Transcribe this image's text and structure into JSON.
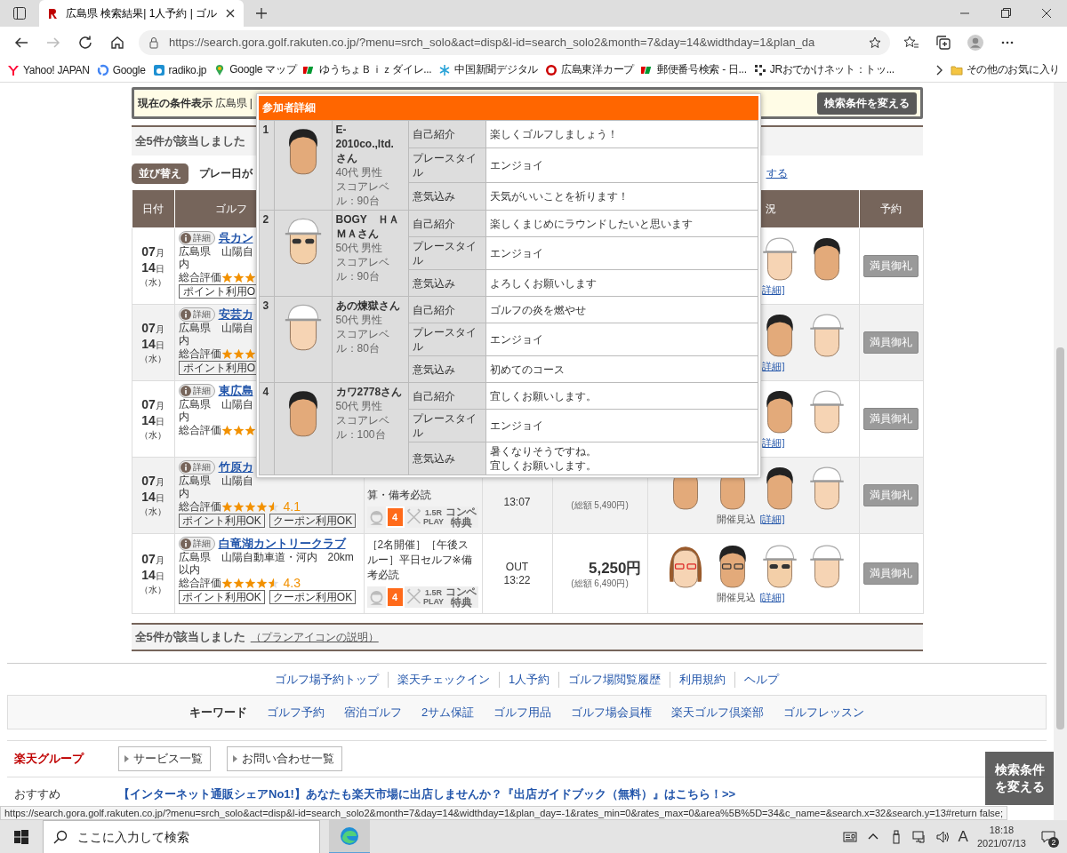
{
  "browser": {
    "tab_title": "広島県 検索結果| 1人予約 | ゴル",
    "address": "https://search.gora.golf.rakuten.co.jp/?menu=srch_solo&act=disp&l-id=search_solo2&month=7&day=14&widthday=1&plan_da",
    "bookmarks": [
      {
        "kind": "yahoo",
        "label": "Yahoo! JAPAN"
      },
      {
        "kind": "google",
        "label": "Google"
      },
      {
        "kind": "radio",
        "label": "radiko.jp"
      },
      {
        "kind": "pin",
        "label": "Google マップ"
      },
      {
        "kind": "post",
        "label": "ゆうちょＢｉｚダイレ..."
      },
      {
        "kind": "snow",
        "label": "中国新聞デジタル"
      },
      {
        "kind": "ball",
        "label": "広島東洋カープ"
      },
      {
        "kind": "post",
        "label": "郵便番号検索 - 日..."
      },
      {
        "kind": "grid",
        "label": "JRおでかけネット：トッ..."
      }
    ],
    "other_favorites": "その他のお気に入り"
  },
  "condition_bar": {
    "label": "現在の条件表示",
    "value": "広島県 |",
    "button": "検索条件を変える"
  },
  "result_count_top": "全5件が該当しました",
  "sort": {
    "button": "並び替え",
    "current": "プレー日が",
    "link": "する"
  },
  "table": {
    "header": {
      "date": "日付",
      "course": "ゴルフ",
      "status": "況",
      "reserve": "予約"
    },
    "rows": [
      {
        "month": "07",
        "month_unit": "月",
        "day": "14",
        "day_unit": "日",
        "weekday": "（水）",
        "badge": "詳細",
        "course": "呉カン",
        "address": "広島県　山陽自",
        "address_tail": "内",
        "rating_label": "総合評価",
        "stars": 3,
        "coupons": [
          "ポイント利用O"
        ],
        "avatars": [
          {
            "kind": "cap"
          },
          {
            "kind": "hair"
          }
        ],
        "status_link": "詳細]",
        "reserve": "満員御礼"
      },
      {
        "month": "07",
        "month_unit": "月",
        "day": "14",
        "day_unit": "日",
        "weekday": "（水）",
        "badge": "詳細",
        "course": "安芸カ",
        "address": "広島県　山陽自",
        "address_tail": "内",
        "rating_label": "総合評価",
        "stars": 3,
        "coupons": [
          "ポイント利用O"
        ],
        "avatars": [
          {
            "kind": "hair"
          },
          {
            "kind": "cap"
          }
        ],
        "status_link": "詳細]",
        "reserve": "満員御礼"
      },
      {
        "month": "07",
        "month_unit": "月",
        "day": "14",
        "day_unit": "日",
        "weekday": "（水）",
        "badge": "詳細",
        "course": "東広島",
        "address": "広島県　山陽自",
        "address_tail": "内",
        "rating_label": "総合評価",
        "stars": 3,
        "avatars": [
          {
            "kind": "hair"
          },
          {
            "kind": "cap"
          }
        ],
        "status_link": "詳細]",
        "reserve": "満員御礼"
      },
      {
        "month": "07",
        "month_unit": "月",
        "day": "14",
        "day_unit": "日",
        "weekday": "（水）",
        "badge": "詳細",
        "course": "竹原カ",
        "address": "広島県　山陽自",
        "address_tail": "内",
        "rating_label": "総合評価",
        "stars": 4.5,
        "rating": "4.1",
        "coupons": [
          "ポイント利用OK",
          "クーポン利用OK"
        ],
        "plan": "算・備考必読",
        "plan_icons": [
          {
            "kind": "caddie",
            "active": false
          },
          {
            "kind": "cart",
            "label": "4",
            "active": true
          },
          {
            "kind": "meal",
            "active": false
          },
          {
            "kind": "play",
            "label": "1.5R PLAY",
            "active": false
          },
          {
            "kind": "compe",
            "label": "コンペ特典",
            "active": false
          }
        ],
        "time": "13:07",
        "total": "(総額 5,490円)",
        "avatars": [
          {
            "kind": "plain"
          },
          {
            "kind": "plain"
          },
          {
            "kind": "hair"
          },
          {
            "kind": "cap"
          }
        ],
        "status_note": "開催見込",
        "status_link": "[詳細]",
        "reserve": "満員御礼"
      },
      {
        "month": "07",
        "month_unit": "月",
        "day": "14",
        "day_unit": "日",
        "weekday": "（水）",
        "badge": "詳細",
        "course": "白竜湖カントリークラブ",
        "address": "広島県　山陽自動車道・河内　20km以内",
        "rating_label": "総合評価",
        "stars": 4.5,
        "rating": "4.3",
        "coupons": [
          "ポイント利用OK",
          "クーポン利用OK"
        ],
        "plan": "［2名開催］［午後スルー］平日セルフ※備考必読",
        "plan_icons": [
          {
            "kind": "caddie",
            "active": false
          },
          {
            "kind": "cart",
            "label": "4",
            "active": true
          },
          {
            "kind": "meal",
            "active": false
          },
          {
            "kind": "play",
            "label": "1.5R PLAY",
            "active": false
          },
          {
            "kind": "compe",
            "label": "コンペ特典",
            "active": false
          }
        ],
        "course_side": "OUT",
        "time": "13:22",
        "price": "5,250円",
        "total": "(総額 6,490円)",
        "avatars": [
          {
            "kind": "woman"
          },
          {
            "kind": "glasses"
          },
          {
            "kind": "sunglasses"
          },
          {
            "kind": "cap"
          }
        ],
        "status_note": "開催見込",
        "status_link": "[詳細]",
        "reserve": "満員御礼"
      }
    ]
  },
  "popup": {
    "title": "参加者詳細",
    "participants": [
      {
        "number": "1",
        "avatar": {
          "kind": "hair"
        },
        "name": "E-2010co.,ltd.さん",
        "profile": "40代 男性",
        "score": "スコアレベル：90台",
        "details": [
          {
            "label": "自己紹介",
            "lines": [
              "楽しくゴルフしましょう！"
            ]
          },
          {
            "label": "プレースタイル",
            "lines": [
              "エンジョイ"
            ]
          },
          {
            "label": "意気込み",
            "lines": [
              "天気がいいことを祈ります！"
            ]
          }
        ]
      },
      {
        "number": "2",
        "avatar": {
          "kind": "sunglasses"
        },
        "name": "BOGY　ＨＡＭＡさん",
        "profile": "50代 男性",
        "score": "スコアレベル：90台",
        "details": [
          {
            "label": "自己紹介",
            "lines": [
              "楽しくまじめにラウンドしたいと思います"
            ]
          },
          {
            "label": "プレースタイル",
            "lines": [
              "エンジョイ"
            ]
          },
          {
            "label": "意気込み",
            "lines": [
              "よろしくお願いします"
            ]
          }
        ]
      },
      {
        "number": "3",
        "avatar": {
          "kind": "cap"
        },
        "name": "あの煉獄さん",
        "profile": "50代 男性",
        "score": "スコアレベル：80台",
        "details": [
          {
            "label": "自己紹介",
            "lines": [
              "ゴルフの炎を燃やせ"
            ]
          },
          {
            "label": "プレースタイル",
            "lines": [
              "エンジョイ"
            ]
          },
          {
            "label": "意気込み",
            "lines": [
              "初めてのコース"
            ]
          }
        ]
      },
      {
        "number": "4",
        "avatar": {
          "kind": "hair"
        },
        "name": "カワ2778さん",
        "profile": "50代 男性",
        "score": "スコアレベル：100台",
        "details": [
          {
            "label": "自己紹介",
            "lines": [
              "宜しくお願いします。"
            ]
          },
          {
            "label": "プレースタイル",
            "lines": [
              "エンジョイ"
            ]
          },
          {
            "label": "意気込み",
            "lines": [
              "暑くなりそうですね。",
              "宜しくお願いします。"
            ]
          }
        ]
      }
    ]
  },
  "result_count_bottom": "全5件が該当しました",
  "icon_help_link": "（プランアイコンの説明）",
  "footer_links": [
    "ゴルフ場予約トップ",
    "楽天チェックイン",
    "1人予約",
    "ゴルフ場閲覧履歴",
    "利用規約",
    "ヘルプ"
  ],
  "keywords": {
    "label": "キーワード",
    "links": [
      "ゴルフ予約",
      "宿泊ゴルフ",
      "2サム保証",
      "ゴルフ用品",
      "ゴルフ場会員権",
      "楽天ゴルフ倶楽部",
      "ゴルフレッスン"
    ]
  },
  "group": {
    "label": "楽天グループ",
    "buttons": [
      "サービス一覧",
      "お問い合わせ一覧"
    ]
  },
  "recommend": {
    "label": "おすすめ",
    "link": "【インターネット通販シェアNo1!】あなたも楽天市場に出店しませんか？『出店ガイドブック（無料）』はこちら！>>"
  },
  "floating_button": "検索条件を変える",
  "status_url": "https://search.gora.golf.rakuten.co.jp/?menu=srch_solo&act=disp&l-id=search_solo2&month=7&day=14&widthday=1&plan_day=-1&rates_min=0&rates_max=0&area%5B%5D=34&c_name=&search.x=32&search.y=13#return false;",
  "taskbar": {
    "search_placeholder": "ここに入力して検索",
    "ime": "A",
    "time": "18:18",
    "date": "2021/07/13",
    "notifications": "2"
  }
}
